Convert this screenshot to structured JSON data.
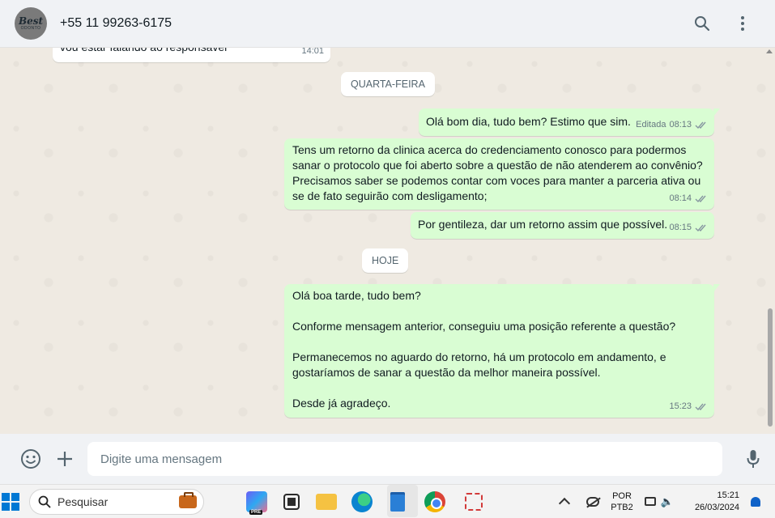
{
  "header": {
    "avatar_logo": "Best",
    "avatar_logo_sub": "ODONTO",
    "contact_name": "+55 11 99263-6175"
  },
  "chat": {
    "messages": [
      {
        "direction": "in",
        "text": "vou estar falando ao responsavel",
        "time": "14:01"
      },
      {
        "direction": "out",
        "text": "Olá bom dia, tudo bem? Estimo que sim.",
        "edited": "Editada",
        "time": "08:13",
        "status": "read"
      },
      {
        "direction": "out",
        "text": "Tens um retorno da clinica acerca do credenciamento conosco para podermos\nsanar o protocolo que foi aberto sobre a questão de não atenderem ao convênio?\nPrecisamos saber se podemos contar com voces para manter a parceria ativa ou\nse de fato seguirão com desligamento;",
        "time": "08:14",
        "status": "read"
      },
      {
        "direction": "out",
        "text": "Por gentileza, dar um retorno assim que possível.",
        "time": "08:15",
        "status": "read"
      },
      {
        "direction": "out",
        "text": "Olá boa tarde, tudo bem?\n\nConforme mensagem anterior, conseguiu uma posição referente a questão?\n\nPermanecemos no aguardo do retorno, há um protocolo em andamento, e\ngostaríamos de sanar a questão da melhor maneira possível.\n\nDesde já agradeço.",
        "time": "15:23",
        "status": "read"
      }
    ],
    "date_separators": [
      "QUARTA-FEIRA",
      "HOJE"
    ]
  },
  "composer": {
    "placeholder": "Digite uma mensagem"
  },
  "taskbar": {
    "search_label": "Pesquisar",
    "copilot_badge": "PRE",
    "lang_line1": "POR",
    "lang_line2": "PTB2",
    "time": "15:21",
    "date": "26/03/2024"
  },
  "colors": {
    "outgoing_bubble": "#d9fdd3",
    "incoming_bubble": "#ffffff",
    "chat_background": "#efeae2",
    "read_tick": "#53bdeb"
  }
}
